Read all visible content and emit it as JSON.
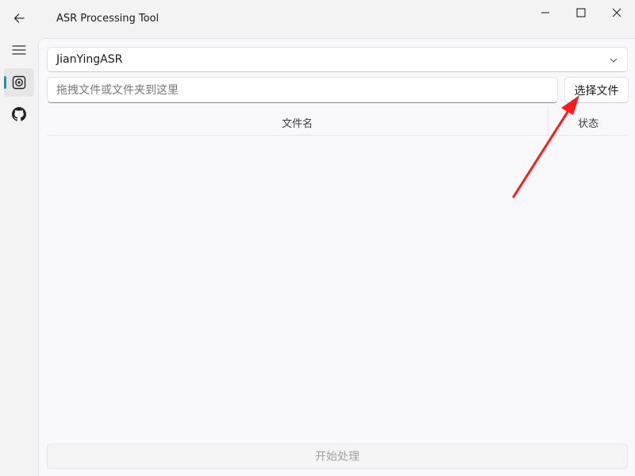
{
  "window": {
    "title": "ASR Processing Tool",
    "controls": [
      "minimize",
      "maximize",
      "close"
    ]
  },
  "nav": {
    "items": [
      {
        "icon": "back-arrow-icon",
        "selected": false
      },
      {
        "icon": "menu-icon",
        "selected": false
      },
      {
        "icon": "record-icon",
        "selected": true
      },
      {
        "icon": "github-icon",
        "selected": false
      }
    ],
    "accent_color": "#009faa"
  },
  "asr_selector": {
    "selected": "JianYingASR"
  },
  "file_input": {
    "placeholder": "拖拽文件或文件夹到这里",
    "value": ""
  },
  "choose_button": {
    "label": "选择文件"
  },
  "table": {
    "columns": [
      "文件名",
      "状态"
    ],
    "rows": []
  },
  "start_button": {
    "label": "开始处理",
    "enabled": false
  },
  "annotation": {
    "color": "#ff1a1a"
  }
}
